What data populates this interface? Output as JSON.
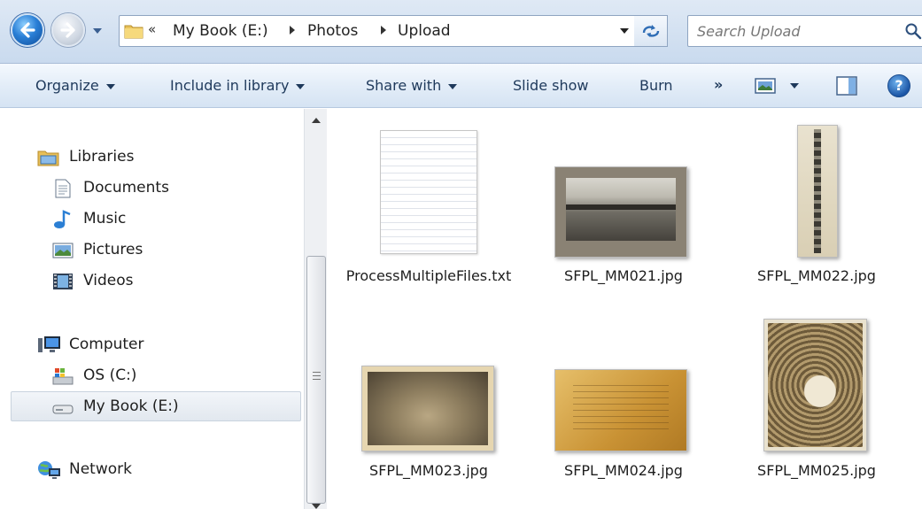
{
  "address_bar": {
    "overflow": "«",
    "breadcrumbs": [
      "My Book (E:)",
      "Photos",
      "Upload"
    ],
    "search_placeholder": "Search Upload"
  },
  "toolbar": {
    "organize": "Organize",
    "include_in_library": "Include in library",
    "share_with": "Share with",
    "slide_show": "Slide show",
    "burn": "Burn",
    "more": "»",
    "help": "?"
  },
  "nav_pane": {
    "libraries": {
      "label": "Libraries",
      "items": [
        "Documents",
        "Music",
        "Pictures",
        "Videos"
      ]
    },
    "computer": {
      "label": "Computer",
      "items": [
        "OS (C:)",
        "My Book (E:)"
      ],
      "selected": "My Book (E:)"
    },
    "network": {
      "label": "Network"
    }
  },
  "files": [
    {
      "name": "ProcessMultipleFiles.txt",
      "type": "text-document-icon"
    },
    {
      "name": "SFPL_MM021.jpg",
      "type": "photo"
    },
    {
      "name": "SFPL_MM022.jpg",
      "type": "photo"
    },
    {
      "name": "SFPL_MM023.jpg",
      "type": "photo"
    },
    {
      "name": "SFPL_MM024.jpg",
      "type": "photo"
    },
    {
      "name": "SFPL_MM025.jpg",
      "type": "photo"
    }
  ]
}
